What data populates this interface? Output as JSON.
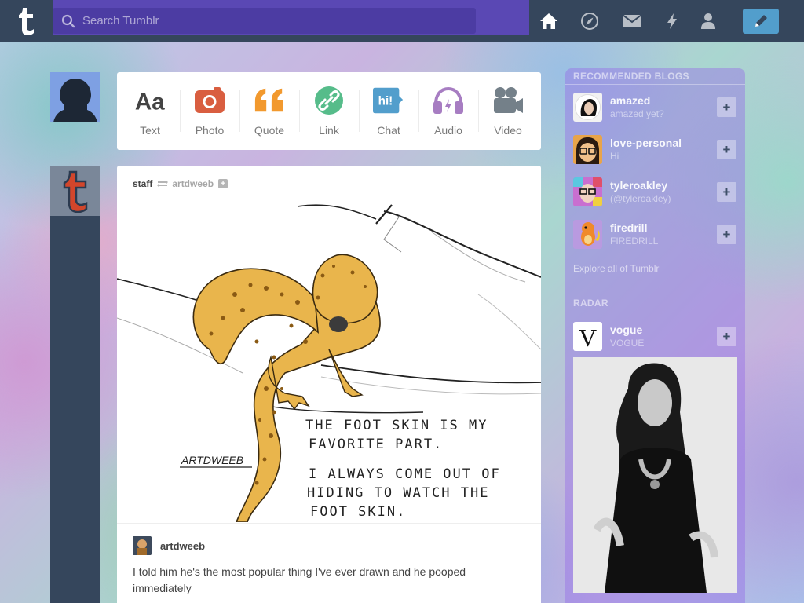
{
  "header": {
    "search_placeholder": "Search Tumblr",
    "nav": [
      "home-icon",
      "explore-icon",
      "inbox-icon",
      "activity-icon",
      "account-icon"
    ],
    "compose": "pencil-icon",
    "colors": {
      "bar": "#35465c",
      "search": "#5a48b4",
      "compose": "#529ecc"
    }
  },
  "post_types": [
    {
      "label": "Text",
      "icon": "text-icon",
      "color": "#444444"
    },
    {
      "label": "Photo",
      "icon": "camera-icon",
      "color": "#d95e40"
    },
    {
      "label": "Quote",
      "icon": "quote-icon",
      "color": "#f2992e"
    },
    {
      "label": "Link",
      "icon": "link-icon",
      "color": "#56bc8a"
    },
    {
      "label": "Chat",
      "icon": "chat-icon",
      "color": "#529ecc"
    },
    {
      "label": "Audio",
      "icon": "headphones-icon",
      "color": "#a77dc2"
    },
    {
      "label": "Video",
      "icon": "video-camera-icon",
      "color": "#748089"
    }
  ],
  "post": {
    "author": "staff",
    "reblogged_from": "artdweeb",
    "image": {
      "signature": "ARTDWEEB",
      "handwriting": [
        "THE FOOT SKIN IS MY",
        "FAVORITE PART.",
        "I ALWAYS COME OUT OF",
        "HIDING TO WATCH THE",
        "FOOT SKIN."
      ]
    },
    "reblog_author": "artdweeb",
    "caption": "I told him he's the most popular thing I've ever drawn and he pooped immediately"
  },
  "sidebar": {
    "recommended_heading": "RECOMMENDED BLOGS",
    "blogs": [
      {
        "name": "amazed",
        "subtitle": "amazed yet?"
      },
      {
        "name": "love-personal",
        "subtitle": "Hi"
      },
      {
        "name": "tyleroakley",
        "subtitle": "(@tyleroakley)"
      },
      {
        "name": "firedrill",
        "subtitle": "FIREDRILL"
      }
    ],
    "explore_link": "Explore all of Tumblr",
    "radar_heading": "RADAR",
    "radar": {
      "name": "vogue",
      "subtitle": "VOGUE",
      "logo": "V"
    }
  }
}
